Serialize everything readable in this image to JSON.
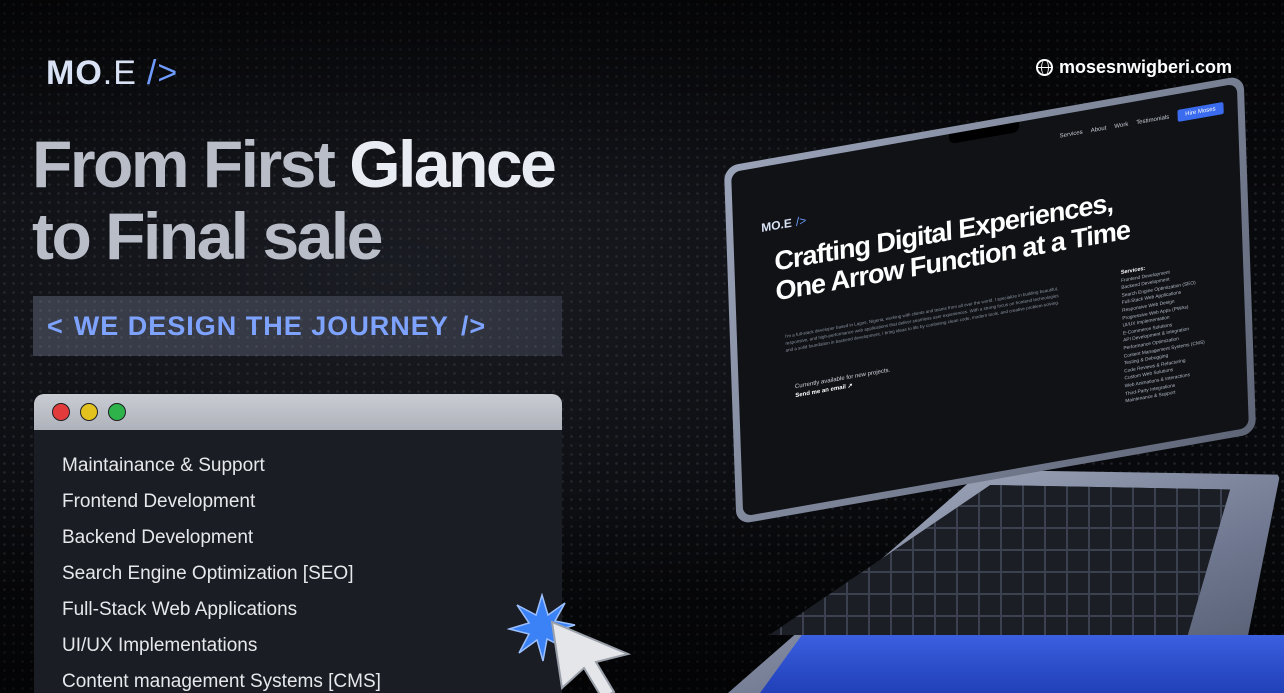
{
  "brand": {
    "logo_bold": "MO",
    "logo_thin": ".E",
    "logo_slash": "/>",
    "site_url": "mosesnwigberi.com"
  },
  "headline": {
    "line1_part1": "From First ",
    "line1_part2": "Glance",
    "line2": "to Final sale"
  },
  "tagline": {
    "open": "<",
    "text": "WE DESIGN THE JOURNEY",
    "close": "/>"
  },
  "services_window": {
    "items": [
      "Maintainance & Support",
      "Frontend Development",
      "Backend Development",
      "Search Engine Optimization [SEO]",
      "Full-Stack Web Applications",
      "UI/UX Implementations",
      "Content management Systems [CMS]"
    ]
  },
  "laptop_screen": {
    "nav": [
      "Services",
      "About",
      "Work",
      "Testimonials"
    ],
    "nav_button": "Hire Moses",
    "logo": "MO.E",
    "logo_slash": "/>",
    "hero": "Crafting Digital Experiences, One Arrow Function at a Time",
    "paragraph": "I'm a full-stack developer based in Lagos, Nigeria, working with clients and teams from all over the world. I specialize in building beautiful, responsive, and high-performance web applications that deliver seamless user experiences. With a strong focus on frontend technologies and a solid foundation in backend development, I bring ideas to life by combining clean code, modern tools, and creative problem-solving.",
    "availability": "Currently available for new projects.",
    "cta_link": "Send me an email ↗",
    "services_heading": "Services:",
    "services": [
      "Frontend Development",
      "Backend Development",
      "Search Engine Optimization (SEO)",
      "Full-Stack Web Applications",
      "Responsive Web Design",
      "Progressive Web Apps (PWAs)",
      "UI/UX Implementation",
      "E-Commerce Solutions",
      "API Development & Integration",
      "Performance Optimization",
      "Content Management Systems (CMS)",
      "Testing & Debugging",
      "Code Reviews & Refactoring",
      "Custom Web Solutions",
      "Web Animations & Interactions",
      "Third-Party Integrations",
      "Maintenance & Support"
    ]
  },
  "colors": {
    "accent": "#7ea3ff",
    "background": "#08090c",
    "window_red": "#e23b3b",
    "window_yellow": "#e3c21f",
    "window_green": "#2eb34a",
    "burst_blue": "#3b82f6"
  }
}
